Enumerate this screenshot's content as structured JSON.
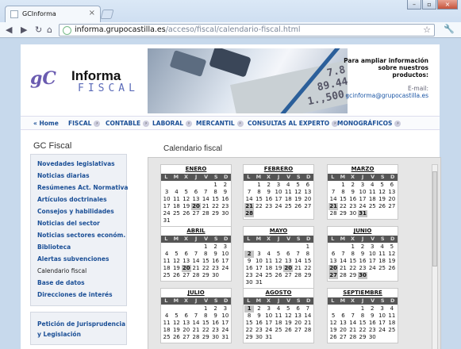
{
  "browser": {
    "tab_title": "GCInforma",
    "url_host": "informa.grupocastilla.es",
    "url_path": "/acceso/fiscal/calendario-fiscal.html"
  },
  "header": {
    "logo_gc": "gC",
    "logo_word1": "Informa",
    "logo_word2": "FISCAL",
    "display_numbers": "7.8\n89.44\n1.,500.",
    "promo_heading": "Para ampliar información sobre nuestros productos:",
    "promo_email_label": "E-mail:",
    "promo_email": "gcinforma@grupocastilla.es"
  },
  "menu": [
    {
      "label": "« Home"
    },
    {
      "label": "FISCAL",
      "active": true
    },
    {
      "label": "CONTABLE"
    },
    {
      "label": "LABORAL"
    },
    {
      "label": "MERCANTIL"
    },
    {
      "label": "CONSULTAS AL EXPERTO"
    },
    {
      "label": "MONOGRÁFICOS"
    }
  ],
  "sidebar": {
    "title": "GC Fiscal",
    "items": [
      "Novedades legislativas",
      "Noticias diarias",
      "Resúmenes Act. Normativa",
      "Artículos doctrinales",
      "Consejos y habilidades",
      "Noticias del sector",
      "Noticias sectores económ.",
      "Biblioteca",
      "Alertas subvenciones",
      "Calendario fiscal",
      "Base de datos",
      "Direcciones de interés"
    ],
    "current": "Calendario fiscal",
    "box2_lines": [
      "Petición de Jurisprudencia",
      "y Legislación"
    ]
  },
  "main": {
    "title": "Calendario fiscal",
    "weekdays": [
      "L",
      "M",
      "X",
      "J",
      "V",
      "S",
      "D"
    ],
    "months": [
      {
        "name": "ENERO",
        "offset": 5,
        "days": 31,
        "highlight": [
          20
        ]
      },
      {
        "name": "FEBRERO",
        "offset": 1,
        "days": 28,
        "highlight": [
          21,
          28
        ]
      },
      {
        "name": "MARZO",
        "offset": 1,
        "days": 31,
        "highlight": [
          21,
          31
        ]
      },
      {
        "name": "ABRIL",
        "offset": 4,
        "days": 30,
        "highlight": [
          20
        ]
      },
      {
        "name": "MAYO",
        "offset": 6,
        "days": 31,
        "highlight": [
          2,
          20
        ]
      },
      {
        "name": "JUNIO",
        "offset": 2,
        "days": 30,
        "highlight": [
          20,
          27,
          30
        ]
      },
      {
        "name": "JULIO",
        "offset": 4,
        "days": 31,
        "highlight": []
      },
      {
        "name": "AGOSTO",
        "offset": 0,
        "days": 31,
        "highlight": [
          1
        ]
      },
      {
        "name": "SEPTIEMBRE",
        "offset": 3,
        "days": 30,
        "highlight": []
      }
    ]
  }
}
